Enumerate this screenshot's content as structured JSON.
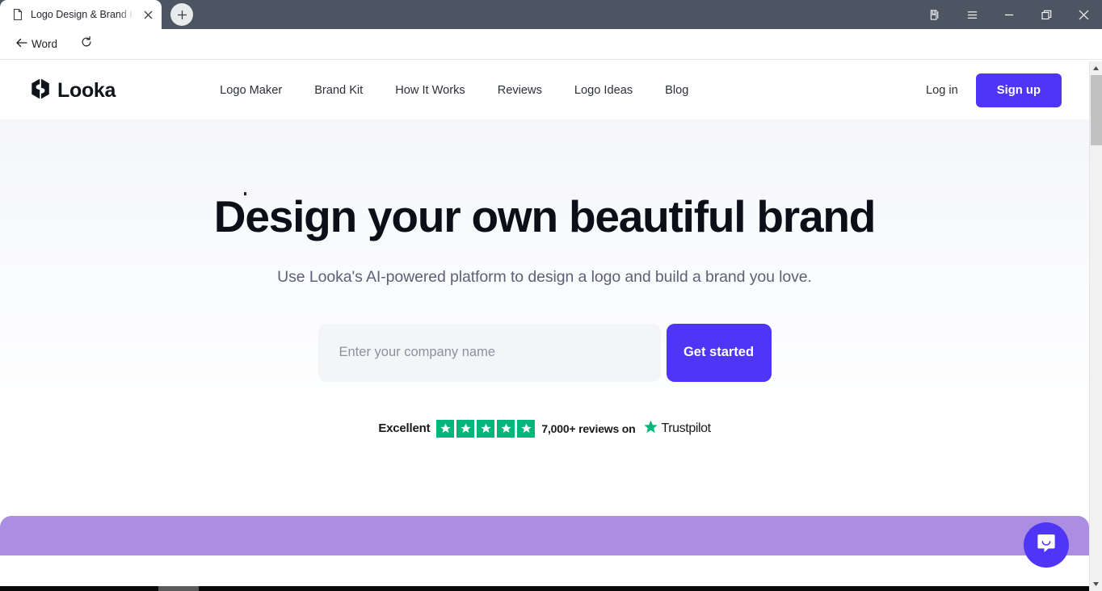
{
  "browser": {
    "tab": {
      "title": "Logo Design & Brand Id",
      "favicon_icon": "page-icon",
      "close_icon": "close-icon"
    },
    "new_tab_icon": "plus-icon",
    "window_controls": [
      {
        "name": "collections",
        "icon": "collections-icon"
      },
      {
        "name": "menu",
        "icon": "hamburger-icon"
      },
      {
        "name": "minimize",
        "icon": "minimize-icon"
      },
      {
        "name": "maximize",
        "icon": "restore-icon"
      },
      {
        "name": "close",
        "icon": "close-icon"
      }
    ],
    "toolbar": {
      "back_label": "Word",
      "back_icon": "back-arrow-icon",
      "reload_icon": "reload-icon"
    }
  },
  "site": {
    "brand": {
      "name": "Looka",
      "logo_icon": "looka-hexagon-icon"
    },
    "nav": [
      {
        "label": "Logo Maker"
      },
      {
        "label": "Brand Kit"
      },
      {
        "label": "How It Works"
      },
      {
        "label": "Reviews"
      },
      {
        "label": "Logo Ideas"
      },
      {
        "label": "Blog"
      }
    ],
    "login_label": "Log in",
    "signup_label": "Sign up",
    "accent_color": "#4f35f5"
  },
  "hero": {
    "title": "Design your own beautiful brand",
    "subtitle": "Use Looka's AI-powered platform to design a logo and build a brand you love.",
    "input_placeholder": "Enter your company name",
    "input_value": "",
    "cta_label": "Get started"
  },
  "trustpilot": {
    "rating_word": "Excellent",
    "stars": 5,
    "star_color": "#00b67a",
    "reviews_text": "7,000+ reviews on",
    "brand_name": "Trustpilot",
    "star_icon": "star-icon"
  },
  "widgets": {
    "chat_launcher_icon": "chat-bubble-icon",
    "chat_launcher_color": "#4f35f5"
  },
  "scrollbar": {
    "up_icon": "caret-up-icon",
    "down_icon": "caret-down-icon",
    "thumb": "scroll-thumb"
  },
  "footer_band": {
    "color": "#ab8ee2"
  }
}
